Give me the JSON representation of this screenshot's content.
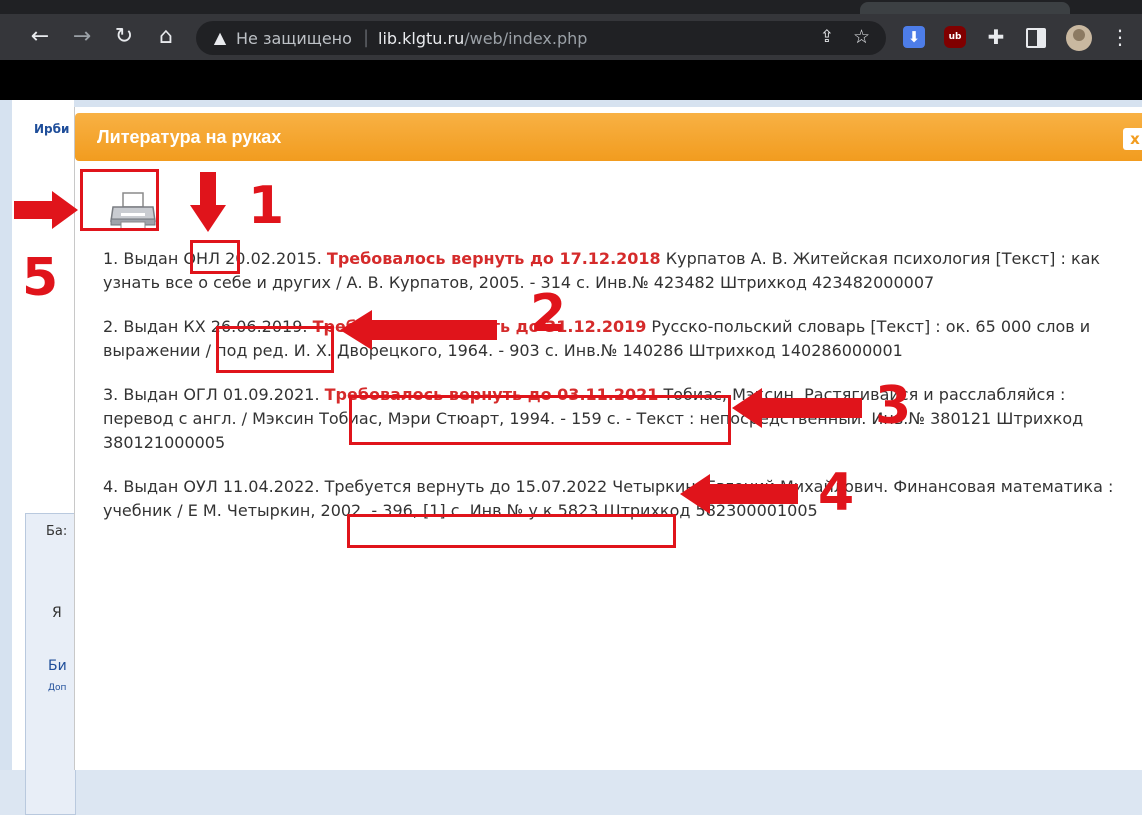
{
  "browser": {
    "security_label": "Не защищено",
    "url_host": "lib.klgtu.ru",
    "url_path": "/web/index.php",
    "extensions": [
      "download-extension-icon",
      "ublock-icon",
      "puzzle-icon",
      "sidebar-icon"
    ],
    "ublock_label": "ub"
  },
  "background_page": {
    "brand_fragment": "Ирби",
    "panel_tab": "Ба:",
    "panel_letter": "Я",
    "panel_link": "Би",
    "panel_small": "Доп"
  },
  "dialog": {
    "title": "Литература на руках",
    "close_label": "x",
    "header_color": "#f29c1f",
    "loans": [
      {
        "prefix_a": "1. Выдан ",
        "dept": "ОНЛ",
        "prefix_b": " 20.02.2015. ",
        "due": "Требовалось вернуть до 17.12.2018",
        "desc": " Курпатов А. В. Житейская психология [Текст] : как узнать все о себе и других / А. В. Курпатов, 2005. - 314 с. Инв.№ 423482 Штрихкод 423482000007"
      },
      {
        "prefix_a": "2. Выдан КХ ",
        "date": "26.06.2019.",
        "due": "Требовалось вернуть до 31.12.2019",
        "desc": " Русско-польский словарь [Текст] : ок. 65 000 слов и выражении / под ред. И. Х. Дворецкого, 1964. - 903 с. Инв.№ 140286 Штрихкод 140286000001"
      },
      {
        "prefix_a": "3. Выдан ОГЛ 01.09.2021. ",
        "due": "Требовалось вернуть до 03.11.2021",
        "desc": " Тобиас, Мэксин. Растягивайся и расслабляйся : перевод с англ. / Мэксин Тобиас, Мэри Стюарт, 1994. - 159 с. - Текст : непосредственный. Инв.№ 380121 Штрихкод 380121000005"
      },
      {
        "prefix_a": "4. Выдан ОУЛ 11.04.2022. ",
        "due": "Требуется вернуть до 15.07.2022",
        "desc": " Четыркин, Евгений Михайлович. Финансовая математика : учебник / Е М. Четыркин, 2002. - 396, [1] с. Инв.№ у.к.5823 Штрихкод 582300001005"
      }
    ]
  },
  "annotations": {
    "numbers": [
      "1",
      "2",
      "3",
      "4",
      "5"
    ],
    "color": "#e0141b"
  }
}
